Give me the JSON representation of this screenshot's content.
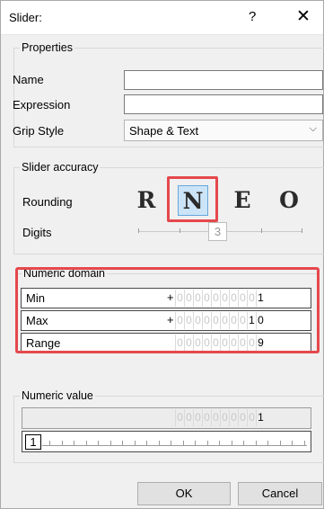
{
  "window": {
    "title": "Slider:",
    "help": "?",
    "close": "✕"
  },
  "properties": {
    "legend": "Properties",
    "name_label": "Name",
    "name_value": "",
    "expression_label": "Expression",
    "expression_value": "",
    "grip_label": "Grip Style",
    "grip_value": "Shape & Text"
  },
  "accuracy": {
    "legend": "Slider accuracy",
    "rounding_label": "Rounding",
    "options": [
      "R",
      "N",
      "E",
      "O"
    ],
    "selected": "N",
    "digits_label": "Digits",
    "digits_value": "3"
  },
  "domain": {
    "legend": "Numeric domain",
    "min": {
      "label": "Min",
      "sign": "+",
      "digits": [
        "0",
        "0",
        "0",
        "0",
        "0",
        "0",
        "0",
        "0",
        "0",
        "1"
      ]
    },
    "max": {
      "label": "Max",
      "sign": "+",
      "digits": [
        "0",
        "0",
        "0",
        "0",
        "0",
        "0",
        "0",
        "0",
        "1",
        "0"
      ]
    },
    "range": {
      "label": "Range",
      "digits": [
        "0",
        "0",
        "0",
        "0",
        "0",
        "0",
        "0",
        "0",
        "0",
        "9"
      ]
    }
  },
  "value": {
    "legend": "Numeric value",
    "digits": [
      "0",
      "0",
      "0",
      "0",
      "0",
      "0",
      "0",
      "0",
      "0",
      "1"
    ],
    "slider_value": "1"
  },
  "buttons": {
    "ok": "OK",
    "cancel": "Cancel"
  },
  "colors": {
    "highlight": "#e5484d",
    "selected_bg": "#cce4f7"
  }
}
